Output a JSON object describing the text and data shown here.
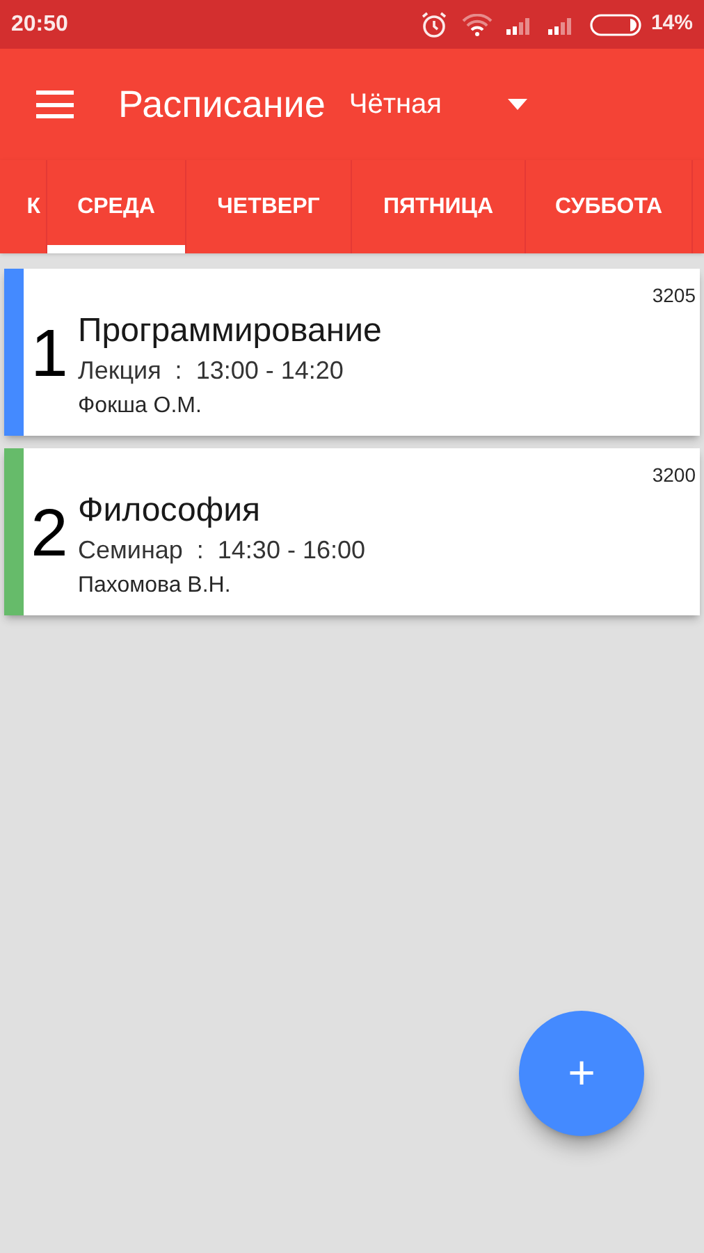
{
  "status_bar": {
    "time": "20:50",
    "battery": "14%"
  },
  "toolbar": {
    "title": "Расписание",
    "week": "Чётная"
  },
  "tabs": [
    {
      "label": "К",
      "selected": false
    },
    {
      "label": "СРЕДА",
      "selected": true
    },
    {
      "label": "ЧЕТВЕРГ",
      "selected": false
    },
    {
      "label": "ПЯТНИЦА",
      "selected": false
    },
    {
      "label": "СУББОТА",
      "selected": false
    }
  ],
  "lessons": [
    {
      "number": "1",
      "room": "3205",
      "subject": "Программирование",
      "details": "Лекция  :  13:00 - 14:20",
      "teacher": "Фокша О.М.",
      "color": "#448aff"
    },
    {
      "number": "2",
      "room": "3200",
      "subject": "Философия",
      "details": "Семинар  :  14:30 - 16:00",
      "teacher": "Пахомова В.Н.",
      "color": "#66bb6a"
    }
  ],
  "fab": {
    "label": "+"
  }
}
